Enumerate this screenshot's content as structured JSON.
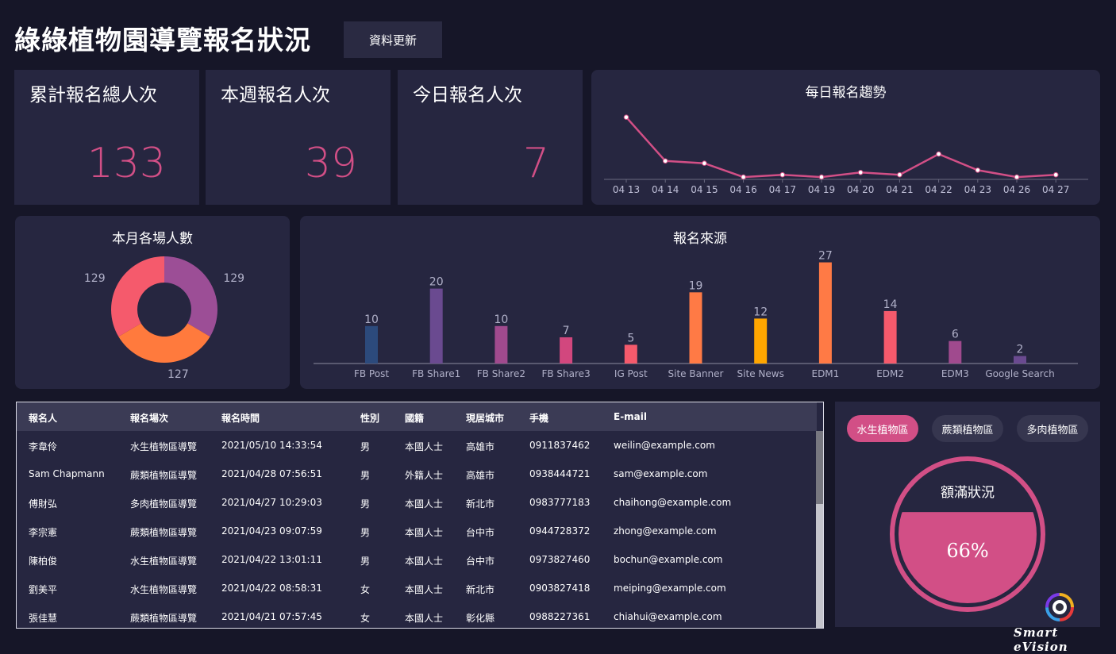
{
  "header": {
    "title": "綠綠植物園導覽報名狀況",
    "refresh_label": "資料更新"
  },
  "stats": [
    {
      "label": "累計報名總人次",
      "value": "133"
    },
    {
      "label": "本週報名人次",
      "value": "39"
    },
    {
      "label": "今日報名人次",
      "value": "7"
    }
  ],
  "trend": {
    "title": "每日報名趨勢"
  },
  "venues": {
    "title": "本月各場人數"
  },
  "sources": {
    "title": "報名來源"
  },
  "accent_color": "#d24f86",
  "chart_data": [
    {
      "type": "line",
      "title": "每日報名趨勢",
      "x": [
        "04 13",
        "04 14",
        "04 15",
        "04 16",
        "04 17",
        "04 19",
        "04 20",
        "04 21",
        "04 22",
        "04 23",
        "04 26",
        "04 27"
      ],
      "values": [
        27,
        8,
        7,
        1,
        2,
        1,
        3,
        2,
        11,
        4,
        1,
        2
      ],
      "color": "#d24f86"
    },
    {
      "type": "pie",
      "title": "本月各場人數",
      "slices": [
        {
          "value": 129,
          "color": "#9c4e96"
        },
        {
          "value": 127,
          "color": "#ff7a3d"
        },
        {
          "value": 129,
          "color": "#f55a6c"
        }
      ]
    },
    {
      "type": "bar",
      "title": "報名來源",
      "categories": [
        "FB Post",
        "FB Share1",
        "FB Share2",
        "FB Share3",
        "IG Post",
        "Site Banner",
        "Site News",
        "EDM1",
        "EDM2",
        "EDM3",
        "Google Search"
      ],
      "values": [
        10,
        20,
        10,
        7,
        5,
        19,
        12,
        27,
        14,
        6,
        2
      ],
      "colors": [
        "#2c4a7c",
        "#6a4a90",
        "#a04a8e",
        "#d2477e",
        "#f55a6c",
        "#ff7a45",
        "#ffa600",
        "#ff7a45",
        "#f55a6c",
        "#a04a8e",
        "#6a4a90"
      ]
    }
  ],
  "table": {
    "headers": [
      "報名人",
      "報名場次",
      "報名時間",
      "性別",
      "國籍",
      "現居城市",
      "手機",
      "E-mail"
    ],
    "rows": [
      [
        "李韋伶",
        "水生植物區導覽",
        "2021/05/10 14:33:54",
        "男",
        "本國人士",
        "高雄市",
        "0911837462",
        "weilin@example.com"
      ],
      [
        "Sam Chapmann",
        "蕨類植物區導覽",
        "2021/04/28 07:56:51",
        "男",
        "外籍人士",
        "高雄市",
        "0938444721",
        "sam@example.com"
      ],
      [
        "傅財弘",
        "多肉植物區導覽",
        "2021/04/27 10:29:03",
        "男",
        "本國人士",
        "新北市",
        "0983777183",
        "chaihong@example.com"
      ],
      [
        "李宗憲",
        "蕨類植物區導覽",
        "2021/04/23 09:07:59",
        "男",
        "本國人士",
        "台中市",
        "0944728372",
        "zhong@example.com"
      ],
      [
        "陳柏俊",
        "水生植物區導覽",
        "2021/04/22 13:01:11",
        "男",
        "本國人士",
        "台中市",
        "0973827460",
        "bochun@example.com"
      ],
      [
        "劉美平",
        "水生植物區導覽",
        "2021/04/22 08:58:31",
        "女",
        "本國人士",
        "新北市",
        "0903827418",
        "meiping@example.com"
      ],
      [
        "張佳慧",
        "蕨類植物區導覽",
        "2021/04/21 07:57:45",
        "女",
        "本國人士",
        "彰化縣",
        "0988227361",
        "chiahui@example.com"
      ]
    ]
  },
  "quota": {
    "tabs": [
      "水生植物區",
      "蕨類植物區",
      "多肉植物區"
    ],
    "active_tab": 0,
    "title": "額滿狀況",
    "percent_label": "66%",
    "fill_fraction": 0.66
  },
  "brand": {
    "text": "Smart eVision"
  }
}
